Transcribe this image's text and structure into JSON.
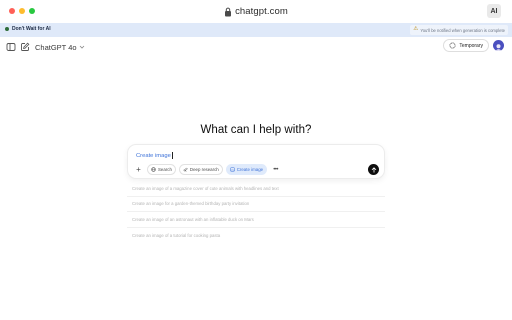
{
  "browser": {
    "url": "chatgpt.com",
    "extension_label": "AI"
  },
  "banner": {
    "title": "Don't Wait for AI",
    "note": "You'll be notified when generation is complete"
  },
  "header": {
    "model": "ChatGPT 4o",
    "temporary_label": "Temporary"
  },
  "main": {
    "headline": "What can I help with?"
  },
  "composer": {
    "input_value": "Create image",
    "tools": [
      {
        "label": "Search",
        "icon": "globe-icon"
      },
      {
        "label": "Deep research",
        "icon": "telescope-icon"
      },
      {
        "label": "Create image",
        "icon": "image-icon",
        "active": true
      }
    ]
  },
  "suggestions": [
    "Create an image of a magazine cover of cute animals with headlines and text",
    "Create an image for a garden-themed birthday party invitation",
    "Create an image of an astronaut with an inflatable duck on Mars",
    "Create an image of a tutorial for cooking pasta"
  ],
  "colors": {
    "accent": "#3f73d9",
    "banner_bg": "#dfe9f9",
    "active_pill_bg": "#dfeafb"
  }
}
